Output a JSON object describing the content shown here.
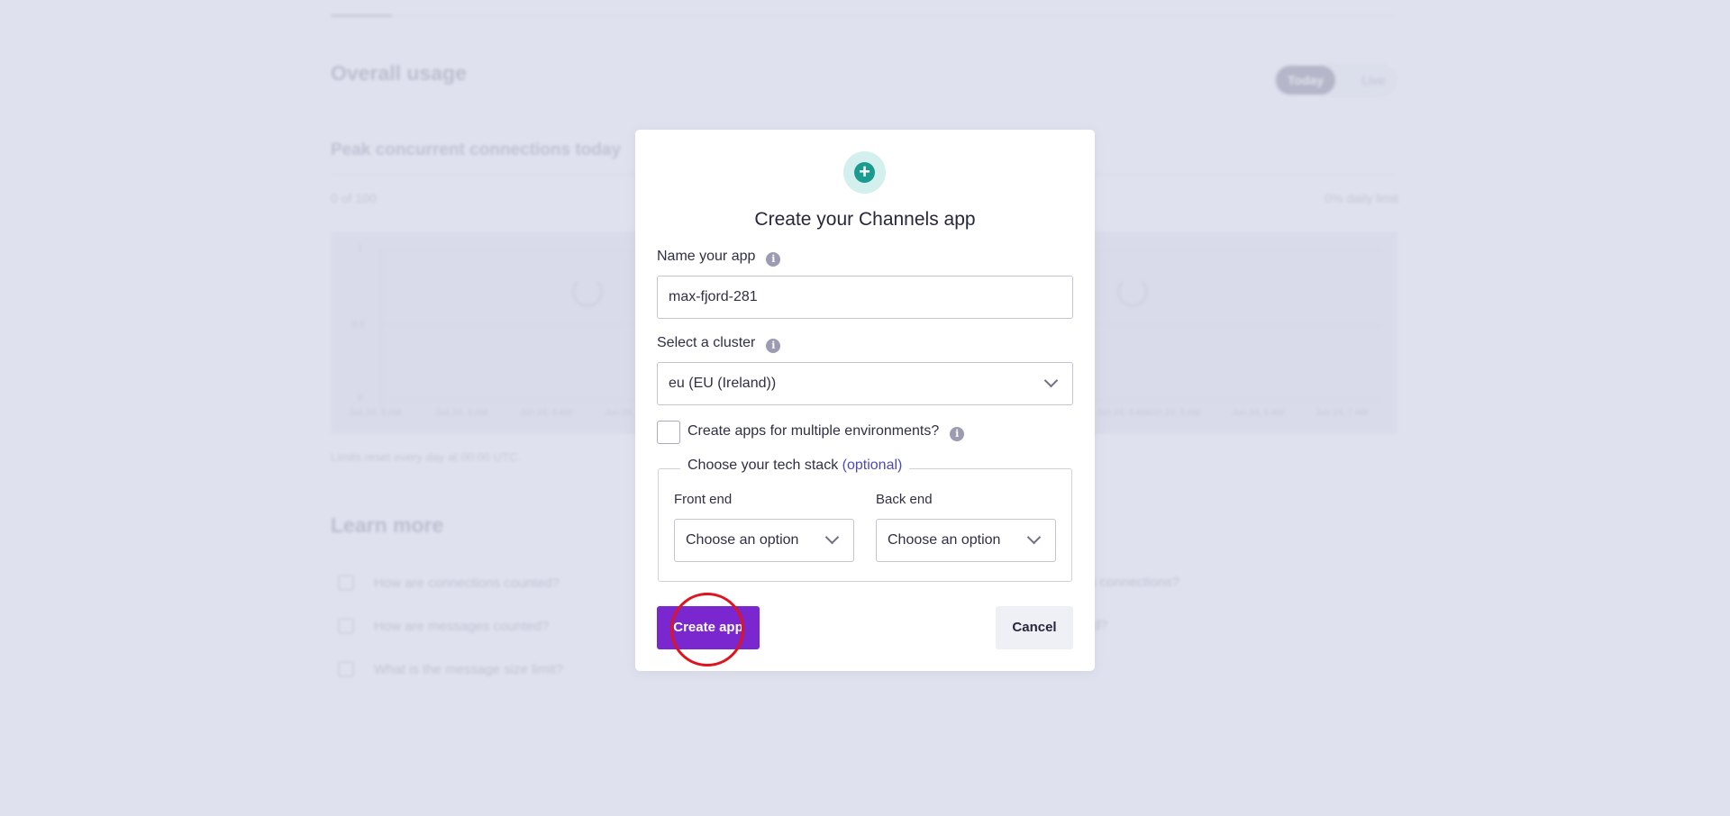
{
  "background": {
    "overall_usage_title": "Overall usage",
    "toggle": {
      "active": "Today",
      "inactive": "Live"
    },
    "peak_title": "Peak concurrent connections today",
    "usage_count": "0 of 100",
    "daily_limit": "0% daily limit",
    "chart_y_labels": [
      "1",
      "0.5",
      "0"
    ],
    "chart_x_labels": [
      "Jun 24, 3 AM",
      "Jun 24, 3 AM",
      "Jun 24, 4 AM",
      "Jun 24, 5 AM",
      "Jun 24, 4 AM",
      "Jun 24, 5 AM",
      "Jun 24, 6 AM",
      "Jun 24, 7 AM"
    ],
    "reset_note": "Limits reset every day at 00:00 UTC.",
    "learn_more_title": "Learn more",
    "faq_left": [
      "How are connections counted?",
      "How are messages counted?",
      "What is the message size limit?"
    ],
    "faq_right": [
      "s connections?",
      "ted?"
    ]
  },
  "modal": {
    "title": "Create your Channels app",
    "name_label": "Name your app",
    "name_value": "max-fjord-281",
    "cluster_label": "Select a cluster",
    "cluster_value": "eu (EU (Ireland))",
    "multi_env_label": "Create apps for multiple environments?",
    "tech_stack_label": "Choose your tech stack",
    "tech_stack_optional": "(optional)",
    "front_end_label": "Front end",
    "front_end_value": "Choose an option",
    "back_end_label": "Back end",
    "back_end_value": "Choose an option",
    "create_button": "Create app",
    "cancel_button": "Cancel"
  },
  "icons": {
    "plus": "plus-circle-icon",
    "info": "info-icon",
    "chevron": "chevron-down-icon"
  },
  "colors": {
    "primary_button": "#7b27d0",
    "plus_badge": "#1a9b8f",
    "click_indicator": "#e0141e"
  }
}
